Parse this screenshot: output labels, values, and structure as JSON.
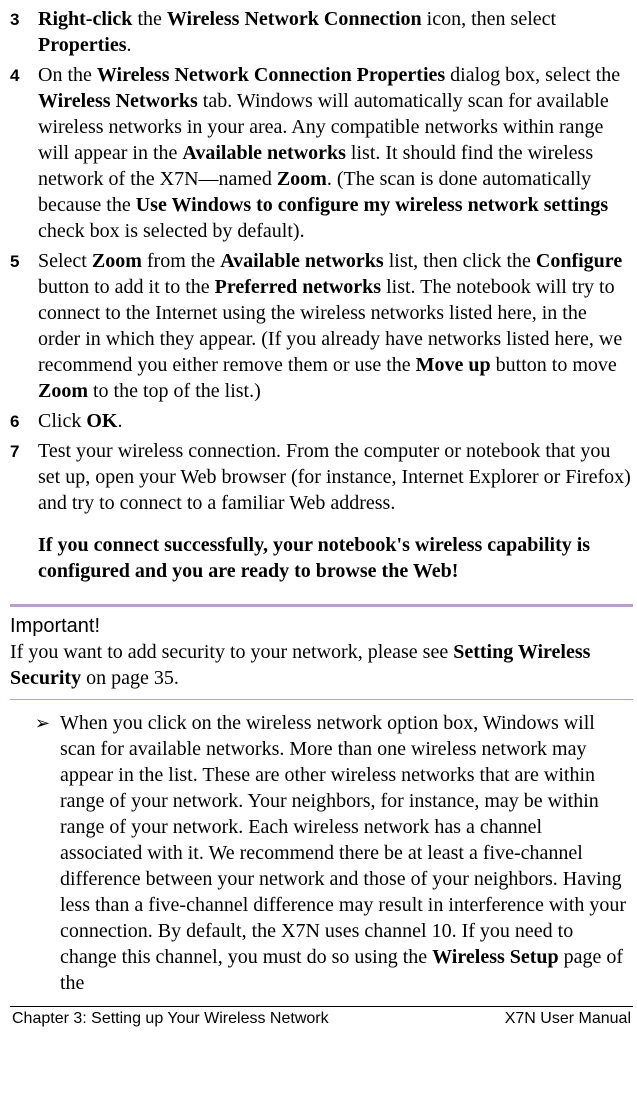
{
  "steps": [
    {
      "num": "3",
      "html": "<b>Right-click</b> the <b>Wireless Network Connection</b> icon, then select <b>Properties</b>."
    },
    {
      "num": "4",
      "html": "On the <b>Wireless Network Connection Properties</b> dialog box, select the <b>Wireless Networks</b> tab. Windows will automatically scan for available wireless networks in your area. Any compatible networks within range will appear in the <b>Available networks</b> list. It should find the wireless network of the X7N—named <b>Zoom</b>. (The scan is done automatically because the <b>Use Windows to configure my wireless network settings</b> check box is selected by default)."
    },
    {
      "num": "5",
      "html": "Select <b>Zoom</b> from the <b>Available networks</b> list, then click the <b>Configure</b> button to add it to the <b>Preferred networks</b> list. The notebook will try to connect to the Internet using the wireless networks listed here, in the order in which they appear. (If you already have networks listed here, we recommend you either remove them or use the <b>Move up</b> button to move <b>Zoom</b> to the top of the list.)"
    },
    {
      "num": "6",
      "html": "Click <b>OK</b>."
    },
    {
      "num": "7",
      "html": "Test your wireless connection. From the computer or notebook that you set up, open your Web browser (for instance, Internet Explorer or Firefox) and try to connect to a familiar Web address."
    }
  ],
  "success_note": "If you connect successfully, your notebook's wireless capability is configured and you are ready to browse the Web!",
  "important": {
    "title": "Important!",
    "html": "If you want to add security to your network, please see <b>Setting Wireless Security</b> on page 35."
  },
  "bullet_html": "When you click on the wireless network option box, Windows will scan for available networks. More than one wireless network may appear in the list. These are other wireless networks that are within range of your network. Your neighbors, for instance, may be within range of your network. Each wireless network has a channel associated with it. We recommend there be at least a five-channel difference between your network and those of your neighbors. Having less than a five-channel difference may result in interference with your connection. By default, the X7N uses channel 10. If you need to change this channel, you must do so using the <b>Wireless Setup</b> page of the",
  "footer": {
    "left": "Chapter 3: Setting up Your Wireless Network",
    "right": "X7N User Manual"
  }
}
